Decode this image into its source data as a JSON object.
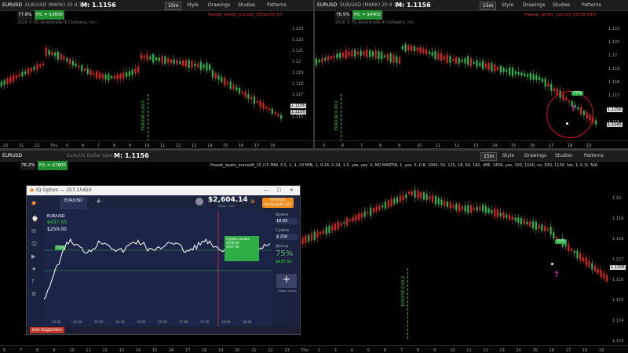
{
  "pane_tl": {
    "symbol": "EURUSD",
    "chart_label": "EUR/USD (MARK) 20 d 15m",
    "mid_price": "M: 1.1156",
    "timeframe": "15m",
    "style_label": "Style",
    "drawings_label": "Drawings",
    "studies_label": "Studies",
    "patterns_label": "Patterns",
    "study_name": "Passat_levels_eurusd_15fast00-10",
    "pct": "77.8%",
    "pl_label": "P/L = $3600",
    "subtitle": "Eur/Usd  3/6/2016 6:45 PM  O: 1.1156  H: 1.1156  L: 1.1155  C: 1.1156",
    "copyright": "2016 © TD Ameritrade IP Company, Inc.",
    "price_box": "1.1156",
    "price_box2": "1.1155",
    "y_ticks": [
      "1.123",
      "1.122",
      "1.121",
      "1.12",
      "1.119",
      "1.118",
      "1.117",
      "1.116",
      "1.115"
    ],
    "x_ticks": [
      "20",
      "21",
      "22",
      "Thu",
      "5",
      "6",
      "7",
      "8",
      "9",
      "10",
      "11",
      "12",
      "13",
      "14",
      "15",
      "16",
      "17",
      "18"
    ],
    "vertical_text": "EURUSD 0,00,0"
  },
  "pane_tr": {
    "symbol": "EURUSD",
    "chart_label": "EUR/USD (MARK) 20 d 15m",
    "mid_price": "M: 1.1156",
    "timeframe": "15m",
    "style_label": "Style",
    "drawings_label": "Drawings",
    "studies_label": "Studies",
    "patterns_label": "Patterns",
    "study_name": "Passat_levels_eurusd_20/15/18/0",
    "pct": "76.5%",
    "pl_label": "P/L = $4900",
    "subtitle": "Eur/Usd  3/6/2016 6:45 PM  O: 1.1156  H: 1.1156  L: 1.1155  C: 1.1156",
    "copyright": "2016 © TD Ameritrade IP Company, Inc.",
    "callout": "77%",
    "price_box": "1.1156",
    "price_box2": "1.1145",
    "y_ticks": [
      "1.122",
      "1.121",
      "1.12",
      "1.119",
      "1.118",
      "1.117",
      "1.116",
      "1.115"
    ],
    "x_ticks": [
      "5",
      "6",
      "7",
      "8",
      "9",
      "10",
      "11",
      "12",
      "13",
      "14",
      "15",
      "16",
      "17",
      "18",
      "19"
    ],
    "vertical_text": "EURUSD 0,00,0"
  },
  "pane_bottom": {
    "symbol": "EURUSD",
    "chart_label": "Euro/US Dollar Spot",
    "mid_price": "M: 1.1156",
    "timeframe": "15m",
    "style_label": "Style",
    "drawings_label": "Drawings",
    "studies_label": "Studies",
    "patterns_label": "Patterns",
    "pct": "76.2%",
    "pl_label": "P/L = $7800",
    "study_line": "Passat_levels_eurusd4_15 (15 MIN, 0.5, 1, 1, 20 MIN, 1, 0.24, 0.24, 1.5, yes, yes, 0, NO MARTIN, 1, yes, 0, 0.8, 1000, 50, 125, 18, 54, 162, 486, 1458, yes, 100, 1500, no, 930, 1130, hei, 1, 0.3): N/A",
    "callout": "75%",
    "price_box": "1.1156",
    "y_ticks": [
      "1.12",
      "1.119",
      "1.118",
      "1.117",
      "1.116",
      "1.115",
      "1.114",
      "1.113"
    ],
    "x_ticks": [
      "6",
      "7",
      "8",
      "9",
      "10",
      "11",
      "12",
      "13",
      "14",
      "15",
      "16",
      "17",
      "18",
      "19",
      "20",
      "21",
      "22",
      "23",
      "Thu",
      "2",
      "3",
      "4",
      "5",
      "6",
      "7",
      "8",
      "9",
      "10",
      "11",
      "12",
      "13",
      "14",
      "15",
      "16",
      "17",
      "18",
      "19"
    ],
    "vertical_text": "EURUSD 0,00,0"
  },
  "iq": {
    "window_title": "IQ Option — 257.15450",
    "asset_tab": "EUR/USD",
    "balance": "$2,604.14",
    "balance_sub": "практ. счёт",
    "open_real": "ОТКРЫТЬ РЕАЛЬНЫЙ СЧЁТ",
    "pair": "EUR/USD",
    "price1": "$437.50",
    "price2": "$250.00",
    "pct_left": "75%",
    "box_title": "Сумма сделки",
    "box_amount": "$250.00",
    "box_profit": "$437.50",
    "time_label": "Время",
    "time_value": "18:00",
    "sum_label": "Сумма",
    "sum_value": "$ 250",
    "profit_label": "Доход",
    "profit_pct": "75%",
    "profit_value": "$437.50",
    "add_label": "Новая опция",
    "x_ticks": [
      "14:00",
      "14:30",
      "15:00",
      "15:30",
      "16:00",
      "16:30",
      "17:00",
      "17:30",
      "18:00",
      "18:30"
    ],
    "foot": "МОЯ ПОДДЕРЖКА"
  },
  "colors": {
    "up": "#2db34a",
    "down": "#d3241f",
    "accent": "#f28c1a",
    "iq_bg": "#1c2548"
  }
}
